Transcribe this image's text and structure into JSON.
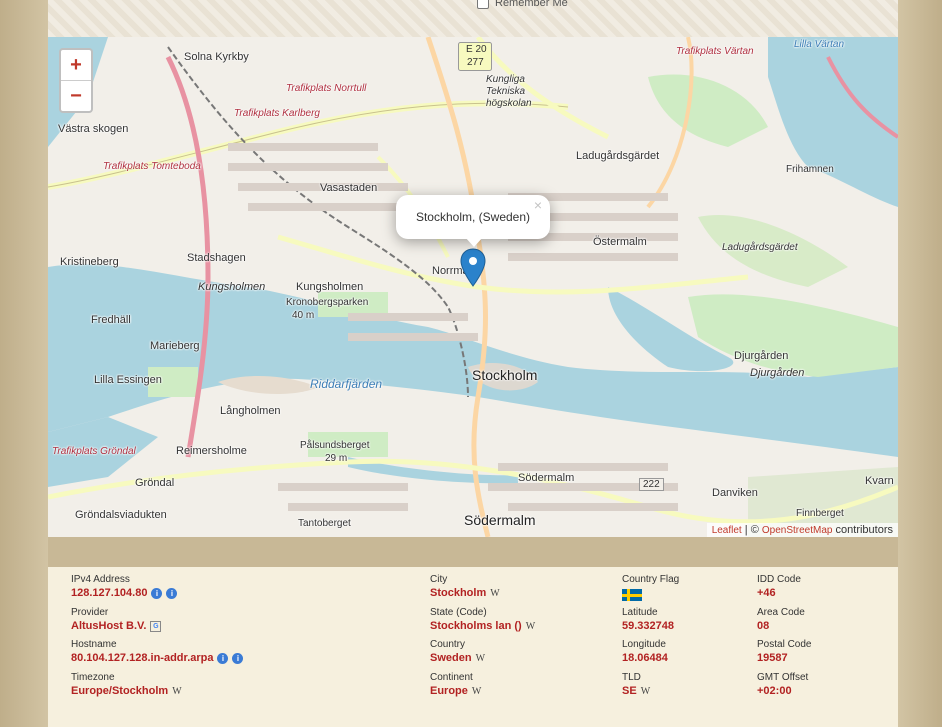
{
  "login": {
    "remember_label": "Remember Me"
  },
  "map": {
    "zoom_in": "+",
    "zoom_out": "−",
    "popup_text": "Stockholm, (Sweden)",
    "popup_close": "×",
    "attribution": {
      "leaflet": "Leaflet",
      "separator": " | © ",
      "osm": "OpenStreetMap",
      "suffix": " contributors"
    },
    "labels": {
      "solna_kyrkby": "Solna Kyrkby",
      "vastra_skogen": "Västra skogen",
      "kristineberg": "Kristineberg",
      "kungsholmen": "Kungsholmen",
      "kungsholmen2": "Kungsholmen",
      "stadshagen": "Stadshagen",
      "vasastaden": "Vasastaden",
      "ostermalm": "Östermalm",
      "norrmalm": "Norrmalm",
      "stockholm": "Stockholm",
      "marieberg": "Marieberg",
      "fredhall": "Fredhäll",
      "lilla_essingen": "Lilla Essingen",
      "langholmen": "Långholmen",
      "reimersholme": "Reimersholme",
      "grondal": "Gröndal",
      "grondalsviadukten": "Gröndalsviadukten",
      "sodermalm": "Södermalm",
      "sodermalm_big": "Södermalm",
      "djurgarden": "Djurgården",
      "djurgarden2": "Djurgården",
      "danviken": "Danviken",
      "ladugardsgardet": "Ladugårdsgärdet",
      "ladugardsgardet2": "Ladugårdsgärdet",
      "frihamnen": "Frihamnen",
      "lilla_vartan": "Lilla Värtan",
      "riddarfjarden": "Riddarfjärden",
      "kronobergsparken": "Kronobergsparken",
      "kronobergsparken_h": "40 m",
      "palsundsberget": "Pålsundsberget",
      "palsundsberget_h": "29 m",
      "tantoberget": "Tantoberget",
      "finnberget": "Finnberget",
      "kvarn": "Kvarn",
      "kth": "Kungliga\nTekniska\nhögskolan",
      "trafikplats_karlberg": "Trafikplats Karlberg",
      "trafikplats_norrtull": "Trafikplats Norrtull",
      "trafikplats_tomteboda": "Trafikplats Tomteboda",
      "trafikplats_vartan": "Trafikplats Värtan",
      "trafikplats_grondal": "Trafikplats Gröndal",
      "e20": "E 20",
      "r277": "277",
      "r222": "222"
    }
  },
  "info": {
    "ipv4": {
      "label": "IPv4 Address",
      "value": "128.127.104.80"
    },
    "provider": {
      "label": "Provider",
      "value": "AltusHost B.V."
    },
    "hostname": {
      "label": "Hostname",
      "value": "80.104.127.128.in-addr.arpa"
    },
    "timezone": {
      "label": "Timezone",
      "value": "Europe/Stockholm"
    },
    "city": {
      "label": "City",
      "value": "Stockholm"
    },
    "state": {
      "label": "State (Code)",
      "value": "Stockholms lan ()"
    },
    "country": {
      "label": "Country",
      "value": "Sweden"
    },
    "continent": {
      "label": "Continent",
      "value": "Europe"
    },
    "flag": {
      "label": "Country Flag"
    },
    "latitude": {
      "label": "Latitude",
      "value": "59.332748"
    },
    "longitude": {
      "label": "Longitude",
      "value": "18.06484"
    },
    "tld": {
      "label": "TLD",
      "value": "SE"
    },
    "idd": {
      "label": "IDD Code",
      "value": "+46"
    },
    "area": {
      "label": "Area Code",
      "value": "08"
    },
    "postal": {
      "label": "Postal Code",
      "value": "19587"
    },
    "gmt": {
      "label": "GMT Offset",
      "value": "+02:00"
    }
  }
}
